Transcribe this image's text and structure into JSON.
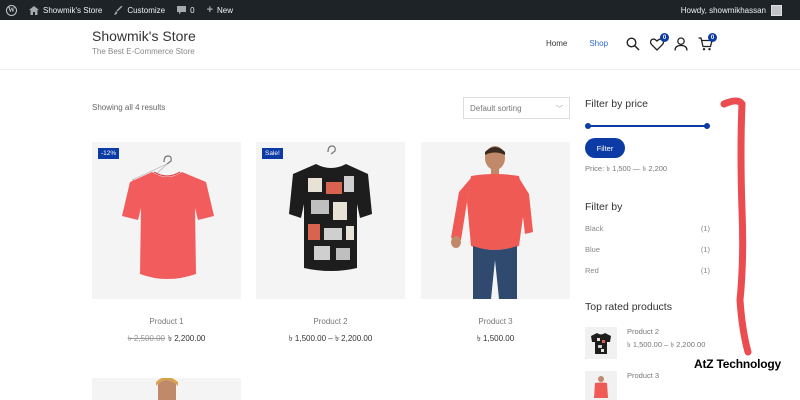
{
  "adminbar": {
    "site_name": "Showmik's Store",
    "customize": "Customize",
    "comments_count": "0",
    "new_label": "New",
    "greeting": "Howdy, showmikhassan"
  },
  "header": {
    "title": "Showmik's Store",
    "tagline": "The Best E-Commerce Store",
    "nav": [
      {
        "label": "Home"
      },
      {
        "label": "Shop"
      }
    ],
    "wishlist_count": "0",
    "cart_count": "0"
  },
  "shop": {
    "result_count": "Showing all 4 results",
    "sorting_selected": "Default sorting",
    "products": [
      {
        "name": "Product 1",
        "badge": "-12%",
        "old_price": "৳ 2,500.00",
        "price": "৳ 2,200.00"
      },
      {
        "name": "Product 2",
        "badge": "Sale!",
        "old_price": "",
        "price": "৳ 1,500.00 – ৳ 2,200.00"
      },
      {
        "name": "Product 3",
        "badge": "",
        "old_price": "",
        "price": "৳ 1,500.00"
      }
    ]
  },
  "sidebar": {
    "filter_price_title": "Filter by price",
    "filter_button": "Filter",
    "price_range": "Price: ৳ 1,500 — ৳ 2,200",
    "filter_by_title": "Filter by",
    "attributes": [
      {
        "label": "Black",
        "count": "(1)"
      },
      {
        "label": "Blue",
        "count": "(1)"
      },
      {
        "label": "Red",
        "count": "(1)"
      }
    ],
    "top_rated_title": "Top rated products",
    "top_rated": [
      {
        "name": "Product 2",
        "price": "৳ 1,500.00 – ৳ 2,200.00"
      },
      {
        "name": "Product 3",
        "price": ""
      }
    ]
  },
  "overlay": {
    "watermark": "AtZ Technology"
  },
  "colors": {
    "accent": "#0d3ba6",
    "link_active": "#2a6ad6",
    "shirt_red": "#f25c5c",
    "adminbar_bg": "#1d2327",
    "annotation_red": "#e8383d"
  }
}
